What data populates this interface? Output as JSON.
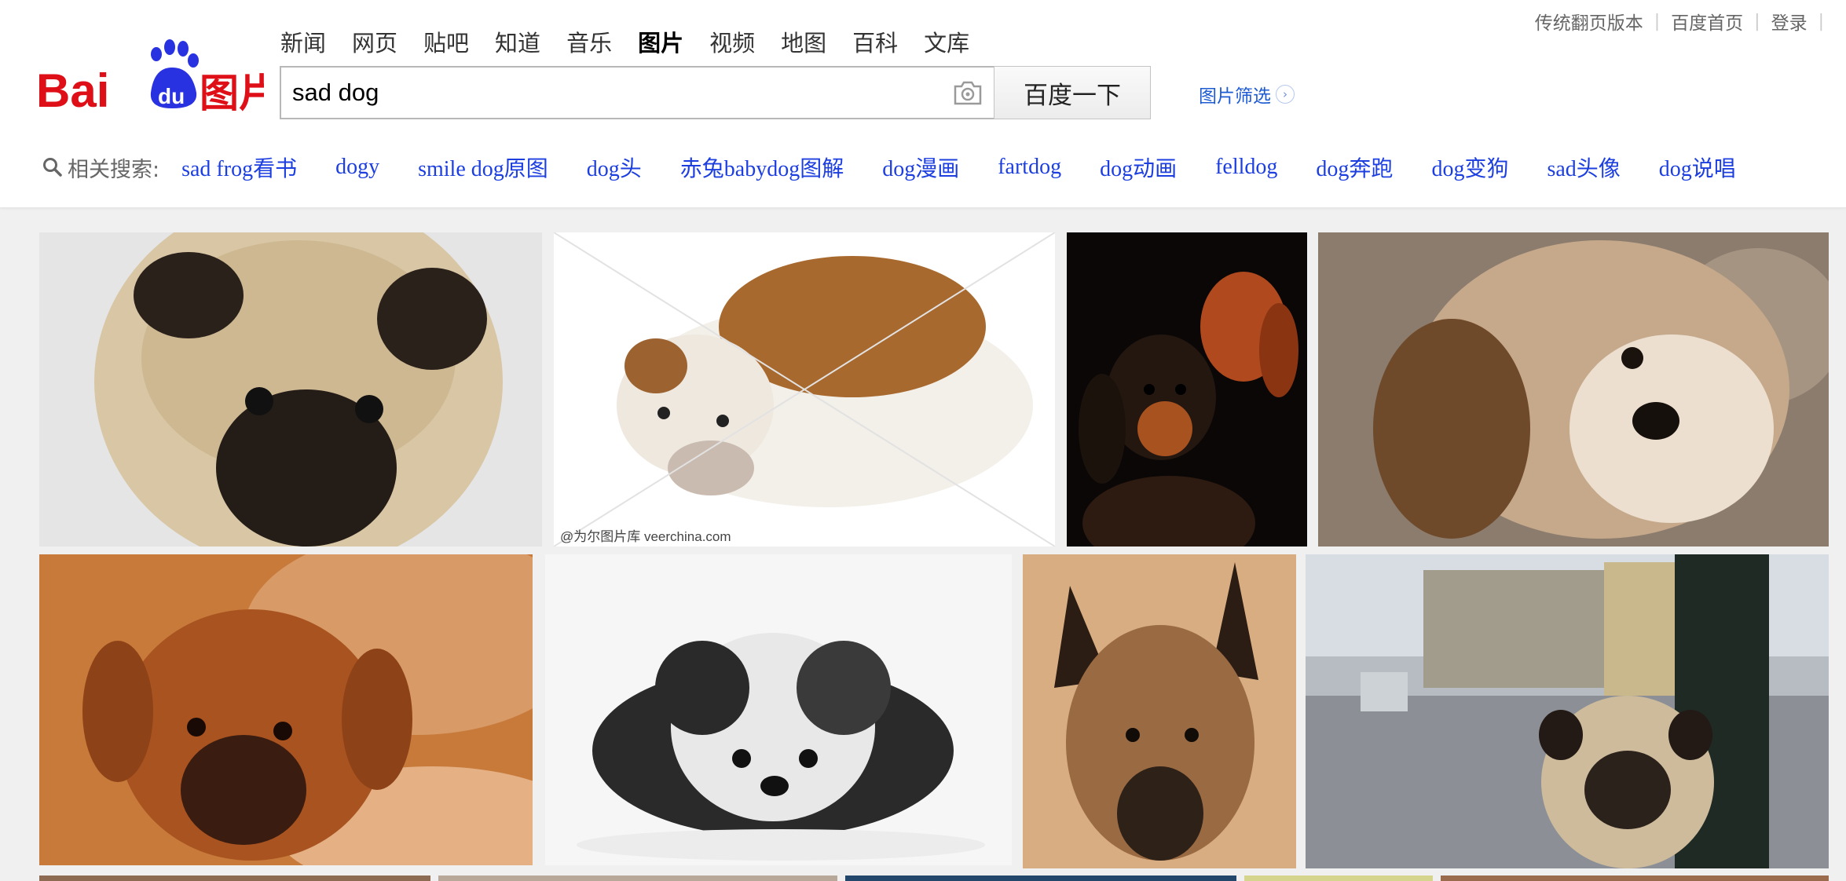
{
  "top_links": {
    "classic": "传统翻页版本",
    "home": "百度首页",
    "login": "登录"
  },
  "logo": {
    "brand": "Bai",
    "du": "du",
    "product": "图片"
  },
  "nav": [
    {
      "label": "新闻",
      "active": false
    },
    {
      "label": "网页",
      "active": false
    },
    {
      "label": "贴吧",
      "active": false
    },
    {
      "label": "知道",
      "active": false
    },
    {
      "label": "音乐",
      "active": false
    },
    {
      "label": "图片",
      "active": true
    },
    {
      "label": "视频",
      "active": false
    },
    {
      "label": "地图",
      "active": false
    },
    {
      "label": "百科",
      "active": false
    },
    {
      "label": "文库",
      "active": false
    }
  ],
  "search": {
    "query": "sad dog",
    "button_label": "百度一下",
    "camera_icon": "camera-icon"
  },
  "filter": {
    "label": "图片筛选",
    "icon": "chevron-right-icon"
  },
  "related": {
    "label": "相关搜索:",
    "icon": "search-icon",
    "items": [
      "sad frog看书",
      "dogy",
      "smile dog原图",
      "dog头",
      "赤兔babydog图解",
      "dog漫画",
      "fartdog",
      "dog动画",
      "felldog",
      "dog奔跑",
      "dog变狗",
      "sad头像",
      "dog说唱"
    ]
  },
  "images": [
    {
      "subject": "pug",
      "watermark": ""
    },
    {
      "subject": "bulldog",
      "watermark": "@为尔图片库 veerchina.com"
    },
    {
      "subject": "dachshund puppies",
      "watermark": ""
    },
    {
      "subject": "beagle puppy",
      "watermark": ""
    },
    {
      "subject": "boxer",
      "watermark": ""
    },
    {
      "subject": "shih tzu",
      "watermark": ""
    },
    {
      "subject": "malinois",
      "watermark": ""
    },
    {
      "subject": "pug on street",
      "watermark": ""
    },
    {
      "subject": "partial row",
      "watermark": ""
    },
    {
      "subject": "partial row",
      "watermark": ""
    },
    {
      "subject": "partial row",
      "watermark": ""
    },
    {
      "subject": "partial row",
      "watermark": ""
    },
    {
      "subject": "partial row",
      "watermark": ""
    }
  ],
  "colors": {
    "logo_red": "#de0f17",
    "logo_blue": "#2932e1",
    "link_blue": "#1d3fe0",
    "filter_blue": "#1d5bd3"
  }
}
